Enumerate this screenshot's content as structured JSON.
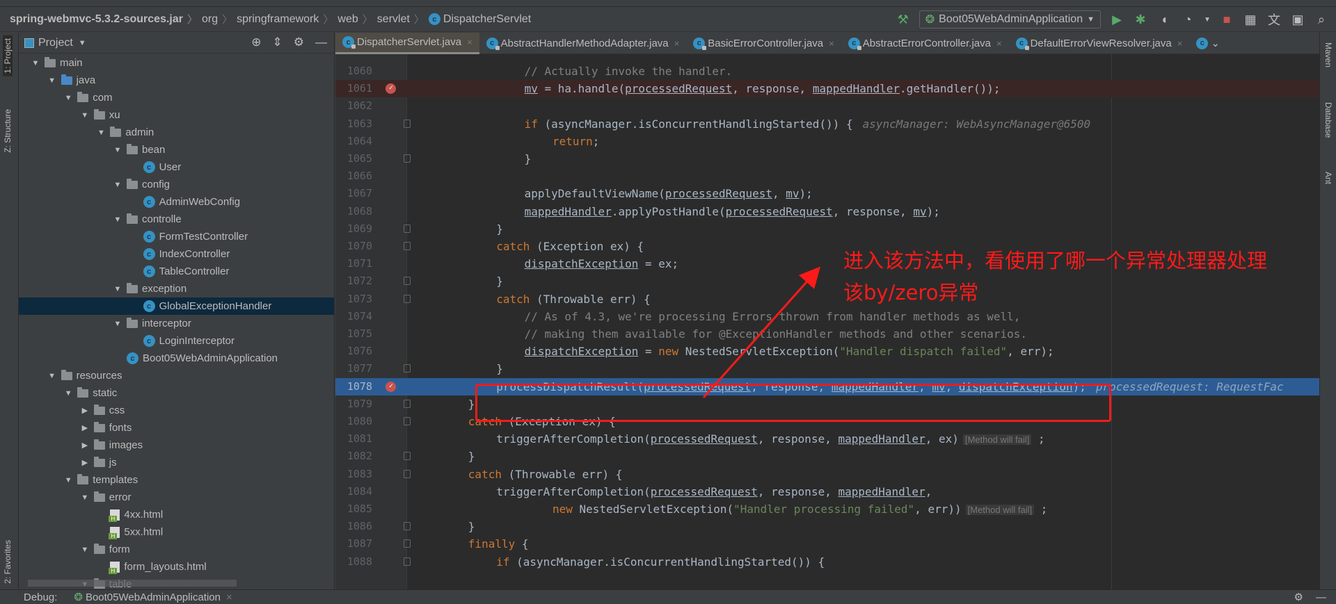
{
  "breadcrumbs": [
    "spring-webmvc-5.3.2-sources.jar",
    "org",
    "springframework",
    "web",
    "servlet",
    "DispatcherServlet"
  ],
  "toolbar": {
    "run_config": "Boot05WebAdminApplication",
    "icons": [
      "hammer-icon",
      "run-icon",
      "debug-icon",
      "coverage-icon",
      "profile-icon",
      "stop-icon",
      "project-structure-icon",
      "translate-icon",
      "terminal-icon",
      "search-icon"
    ]
  },
  "left_strip": {
    "project": "1: Project",
    "structure": "Z: Structure",
    "favorites": "2: Favorites"
  },
  "right_strip": [
    "Maven",
    "Database",
    "Ant"
  ],
  "project_panel": {
    "title": "Project",
    "tree": [
      {
        "label": "main",
        "level": 0,
        "type": "folder",
        "open": true
      },
      {
        "label": "java",
        "level": 1,
        "type": "src",
        "open": true
      },
      {
        "label": "com",
        "level": 2,
        "type": "folder",
        "open": true
      },
      {
        "label": "xu",
        "level": 3,
        "type": "folder",
        "open": true
      },
      {
        "label": "admin",
        "level": 4,
        "type": "folder",
        "open": true
      },
      {
        "label": "bean",
        "level": 5,
        "type": "folder",
        "open": true
      },
      {
        "label": "User",
        "level": 6,
        "type": "class"
      },
      {
        "label": "config",
        "level": 5,
        "type": "folder",
        "open": true
      },
      {
        "label": "AdminWebConfig",
        "level": 6,
        "type": "class"
      },
      {
        "label": "controlle",
        "level": 5,
        "type": "folder",
        "open": true
      },
      {
        "label": "FormTestController",
        "level": 6,
        "type": "class"
      },
      {
        "label": "IndexController",
        "level": 6,
        "type": "class"
      },
      {
        "label": "TableController",
        "level": 6,
        "type": "class"
      },
      {
        "label": "exception",
        "level": 5,
        "type": "folder",
        "open": true
      },
      {
        "label": "GlobalExceptionHandler",
        "level": 6,
        "type": "class",
        "selected": true
      },
      {
        "label": "interceptor",
        "level": 5,
        "type": "folder",
        "open": true
      },
      {
        "label": "LoginInterceptor",
        "level": 6,
        "type": "class"
      },
      {
        "label": "Boot05WebAdminApplication",
        "level": 5,
        "type": "class"
      },
      {
        "label": "resources",
        "level": 1,
        "type": "folder",
        "open": true
      },
      {
        "label": "static",
        "level": 2,
        "type": "folder",
        "open": true
      },
      {
        "label": "css",
        "level": 3,
        "type": "folder",
        "open": false
      },
      {
        "label": "fonts",
        "level": 3,
        "type": "folder",
        "open": false
      },
      {
        "label": "images",
        "level": 3,
        "type": "folder",
        "open": false
      },
      {
        "label": "js",
        "level": 3,
        "type": "folder",
        "open": false
      },
      {
        "label": "templates",
        "level": 2,
        "type": "folder",
        "open": true
      },
      {
        "label": "error",
        "level": 3,
        "type": "folder",
        "open": true
      },
      {
        "label": "4xx.html",
        "level": 4,
        "type": "html"
      },
      {
        "label": "5xx.html",
        "level": 4,
        "type": "html"
      },
      {
        "label": "form",
        "level": 3,
        "type": "folder",
        "open": true
      },
      {
        "label": "form_layouts.html",
        "level": 4,
        "type": "html"
      },
      {
        "label": "table",
        "level": 3,
        "type": "folder",
        "open": true
      }
    ]
  },
  "tabs": [
    {
      "label": "DispatcherServlet.java",
      "active": true
    },
    {
      "label": "AbstractHandlerMethodAdapter.java"
    },
    {
      "label": "BasicErrorController.java"
    },
    {
      "label": "AbstractErrorController.java"
    },
    {
      "label": "DefaultErrorViewResolver.java"
    }
  ],
  "code": [
    {
      "n": "1060",
      "i": 16,
      "t": [
        [
          "c",
          "// Actually invoke the handler."
        ]
      ]
    },
    {
      "n": "1061",
      "i": 16,
      "bp": true,
      "t": [
        [
          "u",
          "mv"
        ],
        [
          "t",
          " = ha.handle("
        ],
        [
          "u",
          "processedRequest"
        ],
        [
          "t",
          ", response, "
        ],
        [
          "u",
          "mappedHandler"
        ],
        [
          "t",
          ".getHandler());"
        ]
      ]
    },
    {
      "n": "1062",
      "i": 0,
      "t": []
    },
    {
      "n": "1063",
      "i": 16,
      "fold": true,
      "t": [
        [
          "k",
          "if"
        ],
        [
          "t",
          " (asyncManager.isConcurrentHandlingStarted()) {"
        ],
        [
          "h",
          "asyncManager: WebAsyncManager@6500"
        ]
      ]
    },
    {
      "n": "1064",
      "i": 20,
      "t": [
        [
          "k",
          "return"
        ],
        [
          "t",
          ";"
        ]
      ]
    },
    {
      "n": "1065",
      "i": 16,
      "fold": true,
      "t": [
        [
          "t",
          "}"
        ]
      ]
    },
    {
      "n": "1066",
      "i": 0,
      "t": []
    },
    {
      "n": "1067",
      "i": 16,
      "t": [
        [
          "t",
          "applyDefaultViewName("
        ],
        [
          "u",
          "processedRequest"
        ],
        [
          "t",
          ", "
        ],
        [
          "u",
          "mv"
        ],
        [
          "t",
          ");"
        ]
      ]
    },
    {
      "n": "1068",
      "i": 16,
      "t": [
        [
          "u",
          "mappedHandler"
        ],
        [
          "t",
          ".applyPostHandle("
        ],
        [
          "u",
          "processedRequest"
        ],
        [
          "t",
          ", response, "
        ],
        [
          "u",
          "mv"
        ],
        [
          "t",
          ");"
        ]
      ]
    },
    {
      "n": "1069",
      "i": 12,
      "fold": true,
      "t": [
        [
          "t",
          "}"
        ]
      ]
    },
    {
      "n": "1070",
      "i": 12,
      "fold": true,
      "t": [
        [
          "k",
          "catch"
        ],
        [
          "t",
          " (Exception ex) {"
        ]
      ]
    },
    {
      "n": "1071",
      "i": 16,
      "t": [
        [
          "u",
          "dispatchException"
        ],
        [
          "t",
          " = ex;"
        ]
      ]
    },
    {
      "n": "1072",
      "i": 12,
      "fold": true,
      "t": [
        [
          "t",
          "}"
        ]
      ]
    },
    {
      "n": "1073",
      "i": 12,
      "fold": true,
      "t": [
        [
          "k",
          "catch"
        ],
        [
          "t",
          " (Throwable err) {"
        ]
      ]
    },
    {
      "n": "1074",
      "i": 16,
      "t": [
        [
          "c",
          "// As of 4.3, we're processing Errors thrown from handler methods as well,"
        ]
      ]
    },
    {
      "n": "1075",
      "i": 16,
      "t": [
        [
          "c",
          "// making them available for @ExceptionHandler methods and other scenarios."
        ]
      ]
    },
    {
      "n": "1076",
      "i": 16,
      "t": [
        [
          "u",
          "dispatchException"
        ],
        [
          "t",
          " = "
        ],
        [
          "k",
          "new"
        ],
        [
          "t",
          " NestedServletException("
        ],
        [
          "s",
          "\"Handler dispatch failed\""
        ],
        [
          "t",
          ", err);"
        ]
      ]
    },
    {
      "n": "1077",
      "i": 12,
      "fold": true,
      "t": [
        [
          "t",
          "}"
        ]
      ]
    },
    {
      "n": "1078",
      "i": 12,
      "bp": true,
      "exec": true,
      "t": [
        [
          "t",
          "processDispatchResult("
        ],
        [
          "u",
          "processedRequest"
        ],
        [
          "t",
          ", response, "
        ],
        [
          "u",
          "mappedHandler"
        ],
        [
          "t",
          ", "
        ],
        [
          "u",
          "mv"
        ],
        [
          "t",
          ", "
        ],
        [
          "u",
          "dispatchException"
        ],
        [
          "t",
          ");"
        ],
        [
          "h",
          "processedRequest: RequestFac"
        ]
      ]
    },
    {
      "n": "1079",
      "i": 8,
      "fold": true,
      "t": [
        [
          "t",
          "}"
        ]
      ]
    },
    {
      "n": "1080",
      "i": 8,
      "fold": true,
      "t": [
        [
          "k",
          "catch"
        ],
        [
          "t",
          " (Exception ex) {"
        ]
      ]
    },
    {
      "n": "1081",
      "i": 12,
      "t": [
        [
          "t",
          "triggerAfterCompletion("
        ],
        [
          "u",
          "processedRequest"
        ],
        [
          "t",
          ", response, "
        ],
        [
          "u",
          "mappedHandler"
        ],
        [
          "t",
          ", ex)"
        ],
        [
          "b",
          "[Method will fail]"
        ],
        [
          "t",
          " ;"
        ]
      ]
    },
    {
      "n": "1082",
      "i": 8,
      "fold": true,
      "t": [
        [
          "t",
          "}"
        ]
      ]
    },
    {
      "n": "1083",
      "i": 8,
      "fold": true,
      "t": [
        [
          "k",
          "catch"
        ],
        [
          "t",
          " (Throwable err) {"
        ]
      ]
    },
    {
      "n": "1084",
      "i": 12,
      "t": [
        [
          "t",
          "triggerAfterCompletion("
        ],
        [
          "u",
          "processedRequest"
        ],
        [
          "t",
          ", response, "
        ],
        [
          "u",
          "mappedHandler"
        ],
        [
          "t",
          ","
        ]
      ]
    },
    {
      "n": "1085",
      "i": 20,
      "t": [
        [
          "k",
          "new"
        ],
        [
          "t",
          " NestedServletException("
        ],
        [
          "s",
          "\"Handler processing failed\""
        ],
        [
          "t",
          ", err))"
        ],
        [
          "b",
          "[Method will fail]"
        ],
        [
          "t",
          " ;"
        ]
      ]
    },
    {
      "n": "1086",
      "i": 8,
      "fold": true,
      "t": [
        [
          "t",
          "}"
        ]
      ]
    },
    {
      "n": "1087",
      "i": 8,
      "fold": true,
      "t": [
        [
          "k",
          "finally"
        ],
        [
          "t",
          " {"
        ]
      ]
    },
    {
      "n": "1088",
      "i": 12,
      "fold": true,
      "t": [
        [
          "k",
          "if"
        ],
        [
          "t",
          " (asyncManager.isConcurrentHandlingStarted()) {"
        ]
      ]
    }
  ],
  "annotation": {
    "line1": "进入该方法中，看使用了哪一个异常处理器处理",
    "line2": "该by/zero异常",
    "color": "#ff1a1a"
  },
  "debug": {
    "label": "Debug:",
    "session": "Boot05WebAdminApplication"
  },
  "colors": {
    "editor_bg": "#2b2b2b",
    "panel_bg": "#3c3f41",
    "keyword": "#cc7832",
    "string": "#6a8759",
    "comment": "#808080",
    "exec_line": "#2d5c94",
    "breakpoint_line": "#3b2626",
    "selection": "#0d293e"
  }
}
